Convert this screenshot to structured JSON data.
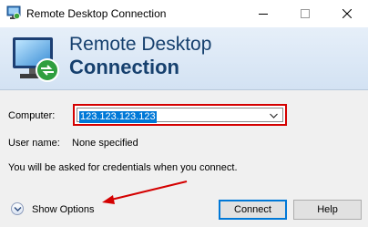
{
  "window": {
    "title": "Remote Desktop Connection"
  },
  "banner": {
    "line1": "Remote Desktop",
    "line2": "Connection"
  },
  "form": {
    "computer_label": "Computer:",
    "computer_value": "123.123.123.123",
    "username_label": "User name:",
    "username_value": "None specified",
    "credentials_message": "You will be asked for credentials when you connect."
  },
  "footer": {
    "show_options_label": "Show Options",
    "connect_label": "Connect",
    "help_label": "Help"
  },
  "colors": {
    "annotation_red": "#d40000",
    "selection_blue": "#0078d7",
    "banner_text": "#16406e"
  }
}
